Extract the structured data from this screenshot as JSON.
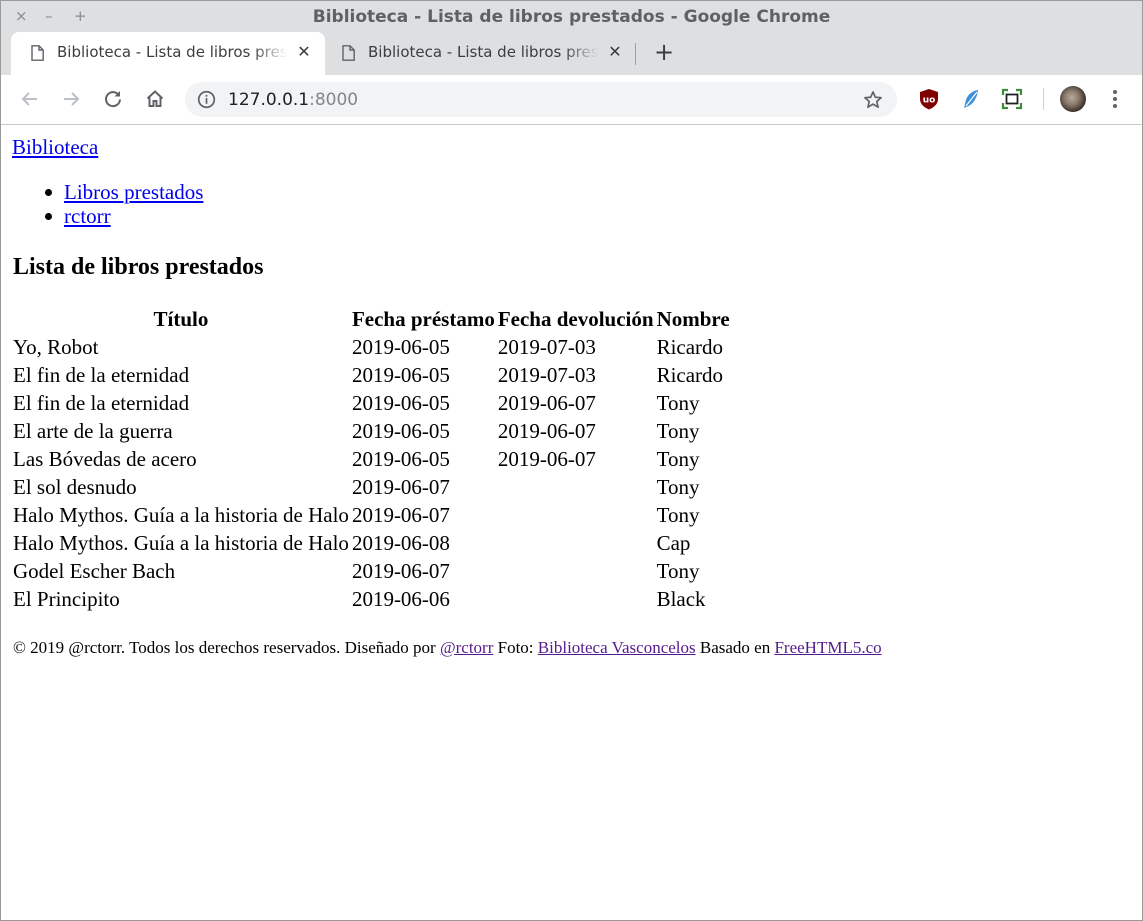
{
  "window": {
    "title": "Biblioteca - Lista de libros prestados - Google Chrome",
    "controls": {
      "close": "×",
      "minimize": "–",
      "maximize": "+"
    }
  },
  "tabs": [
    {
      "label": "Biblioteca - Lista de libros prestados",
      "close": "✕",
      "active": true
    },
    {
      "label": "Biblioteca - Lista de libros prestados",
      "close": "✕",
      "active": false
    }
  ],
  "new_tab_label": "+",
  "omnibox": {
    "host": "127.0.0.1",
    "port": ":8000"
  },
  "icons": {
    "back": "back-arrow-icon",
    "forward": "forward-arrow-icon",
    "reload": "reload-icon",
    "home": "home-icon",
    "info": "info-icon",
    "bookmark": "star-icon",
    "ublock": "ublock-origin-icon",
    "feather": "feather-icon",
    "screenshot": "screen-capture-icon",
    "menu": "kebab-menu-icon"
  },
  "page": {
    "brand": "Biblioteca",
    "nav": [
      "Libros prestados",
      "rctorr"
    ],
    "heading": "Lista de libros prestados",
    "table": {
      "headers": [
        "Título",
        "Fecha préstamo",
        "Fecha devolución",
        "Nombre"
      ],
      "rows": [
        [
          "Yo, Robot",
          "2019-06-05",
          "2019-07-03",
          "Ricardo"
        ],
        [
          "El fin de la eternidad",
          "2019-06-05",
          "2019-07-03",
          "Ricardo"
        ],
        [
          "El fin de la eternidad",
          "2019-06-05",
          "2019-06-07",
          "Tony"
        ],
        [
          "El arte de la guerra",
          "2019-06-05",
          "2019-06-07",
          "Tony"
        ],
        [
          "Las Bóvedas de acero",
          "2019-06-05",
          "2019-06-07",
          "Tony"
        ],
        [
          "El sol desnudo",
          "2019-06-07",
          "",
          "Tony"
        ],
        [
          "Halo Mythos. Guía a la historia de Halo",
          "2019-06-07",
          "",
          "Tony"
        ],
        [
          "Halo Mythos. Guía a la historia de Halo",
          "2019-06-08",
          "",
          "Cap"
        ],
        [
          "Godel Escher Bach",
          "2019-06-07",
          "",
          "Tony"
        ],
        [
          "El Principito",
          "2019-06-06",
          "",
          "Black"
        ]
      ]
    },
    "footer": {
      "copyright": "© 2019 @rctorr. Todos los derechos reservados. Diseñado por ",
      "designer_link": "@rctorr",
      "photo_text": " Foto: ",
      "photo_link": "Biblioteca Vasconcelos",
      "based_text": " Basado en ",
      "based_link": "FreeHTML5.co"
    }
  }
}
